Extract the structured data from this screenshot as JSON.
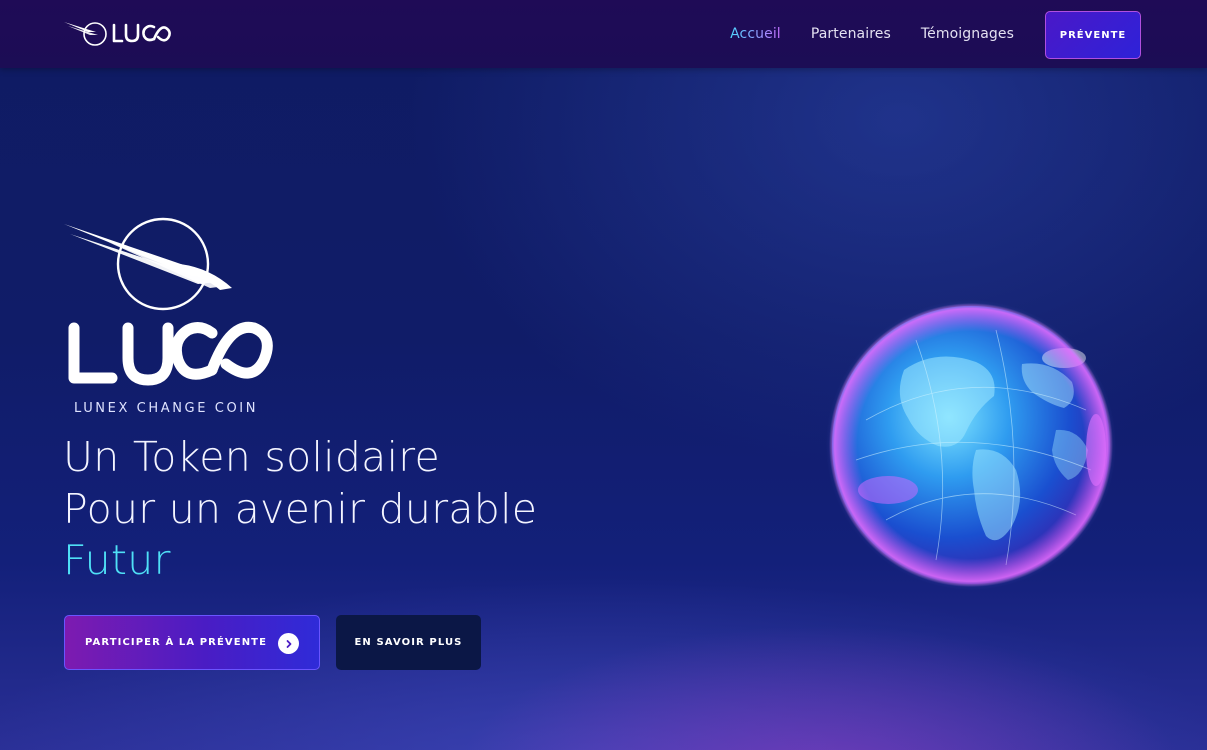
{
  "brand": {
    "logo_text": "LUCO",
    "logo_caption": "LUNEX CHANGE COIN"
  },
  "nav": {
    "items": [
      {
        "label": "Accueil",
        "active": true
      },
      {
        "label": "Partenaires",
        "active": false
      },
      {
        "label": "Témoignages",
        "active": false
      }
    ],
    "presale_label": "PRÉVENTE"
  },
  "hero": {
    "headline_line1": "Un Token solidaire",
    "headline_line2": "Pour un avenir durable",
    "headline_accent": "Futur",
    "cta_primary_label": "PARTICIPER À LA PRÉVENTE",
    "cta_primary_icon": "chevron-right-icon",
    "cta_secondary_label": "EN SAVOIR PLUS"
  },
  "colors": {
    "background": "#101c68",
    "navbar": "#1f0b56",
    "accent_cyan": "#4fe0f6",
    "accent_purple": "#b04fe0",
    "button_dark": "#0b1746"
  }
}
